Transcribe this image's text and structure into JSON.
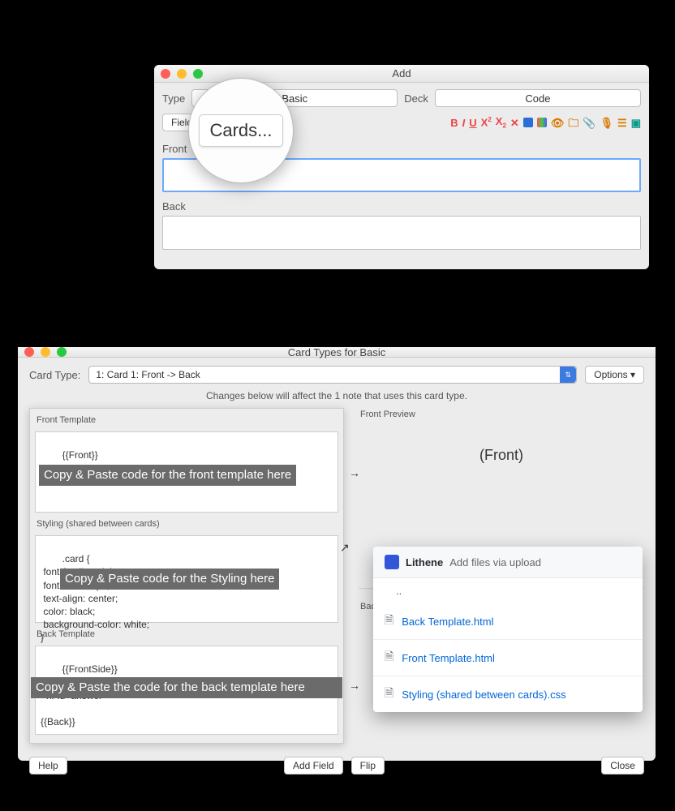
{
  "win1": {
    "title": "Add",
    "type_label": "Type",
    "type_value": "Basic",
    "deck_label": "Deck",
    "deck_value": "Code",
    "fields_btn": "Fields...",
    "cards_btn": "Cards...",
    "front_label": "Front",
    "back_label": "Back",
    "magnified_btn": "Cards...",
    "icons": [
      "B",
      "I",
      "U",
      "X²",
      "X₂",
      "eraser",
      "blue-square",
      "gradient",
      "peek",
      "folder",
      "pin",
      "folder2",
      "mic",
      "calendar",
      "expand"
    ]
  },
  "win2": {
    "title": "Card Types for Basic",
    "cardtype_label": "Card Type:",
    "cardtype_value": "1: Card 1: Front -> Back",
    "options_btn": "Options ▾",
    "notice": "Changes below will affect the 1 note that uses this card type.",
    "front_template_label": "Front Template",
    "front_template_code": "{{Front}}",
    "front_overlay": "Copy & Paste code for the front template here",
    "styling_label": "Styling (shared between cards)",
    "styling_code": ".card {\n font-family: arial;\n font-size: 20px;\n text-align: center;\n color: black;\n background-color: white;\n}",
    "styling_overlay": "Copy & Paste code for the Styling here",
    "back_template_label": "Back Template",
    "back_template_code": "{{FrontSide}}\n\n<hr id=answer>\n\n{{Back}}",
    "back_overlay": "Copy & Paste the code for the back template here",
    "front_preview_label": "Front Preview",
    "front_preview_text": "(Front)",
    "back_preview_label": "Back Preview",
    "help_btn": "Help",
    "addfield_btn": "Add Field",
    "flip_btn": "Flip",
    "close_btn": "Close"
  },
  "float": {
    "author": "Lithene",
    "commit_msg": "Add files via upload",
    "dots": "..",
    "files": [
      "Back Template.html",
      "Front Template.html",
      "Styling (shared between cards).css"
    ]
  }
}
